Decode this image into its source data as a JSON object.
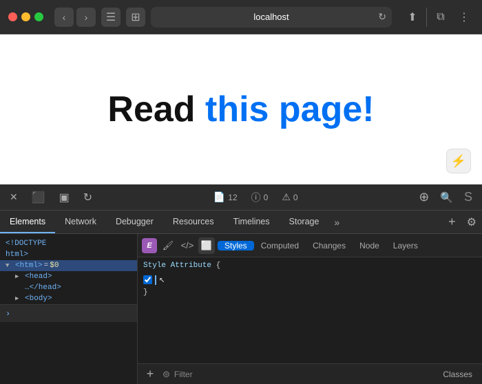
{
  "browser": {
    "url": "localhost",
    "traffic_lights": [
      "red",
      "yellow",
      "green"
    ],
    "back_label": "‹",
    "forward_label": "›",
    "reload_label": "↻",
    "share_label": "⬆",
    "duplicate_label": "⧉",
    "devtools_menu_label": "⋮"
  },
  "webpage": {
    "heading_black": "Read ",
    "heading_blue": "this page!",
    "reader_icon": "⚡"
  },
  "devtools_toolbar": {
    "close_label": "✕",
    "layout_label": "⬛",
    "panel_label": "▣",
    "reload_label": "↻",
    "console_icon": "📄",
    "console_count": "12",
    "warning_icon": "ⓘ",
    "warning_count": "0",
    "error_icon": "⚠",
    "error_count": "0",
    "target_icon": "⊕",
    "search_icon": "🔍"
  },
  "devtools_tabs": [
    {
      "id": "elements",
      "label": "Elements",
      "active": true
    },
    {
      "id": "network",
      "label": "Network",
      "active": false
    },
    {
      "id": "debugger",
      "label": "Debugger",
      "active": false
    },
    {
      "id": "resources",
      "label": "Resources",
      "active": false
    },
    {
      "id": "timelines",
      "label": "Timelines",
      "active": false
    },
    {
      "id": "storage",
      "label": "Storage",
      "active": false
    }
  ],
  "style_subtabs": [
    {
      "id": "styles",
      "label": "Styles",
      "active": true
    },
    {
      "id": "computed",
      "label": "Computed",
      "active": false
    },
    {
      "id": "changes",
      "label": "Changes",
      "active": false
    },
    {
      "id": "node",
      "label": "Node",
      "active": false
    },
    {
      "id": "layers",
      "label": "Layers",
      "active": false
    }
  ],
  "dom": {
    "doctype": "<!DOCTYPE",
    "html_tag": "html>",
    "html_elem": "<html> = $0",
    "head_open": "▶ <head>",
    "head_close": "…</head>",
    "body_tag": "▶ <body>"
  },
  "styles": {
    "rule_name": "Style Attribute",
    "rule_brace_open": "{",
    "rule_brace_close": "}",
    "filter_placeholder": "Filter",
    "classes_label": "Classes",
    "add_icon": "+",
    "filter_icon": "⊜"
  }
}
